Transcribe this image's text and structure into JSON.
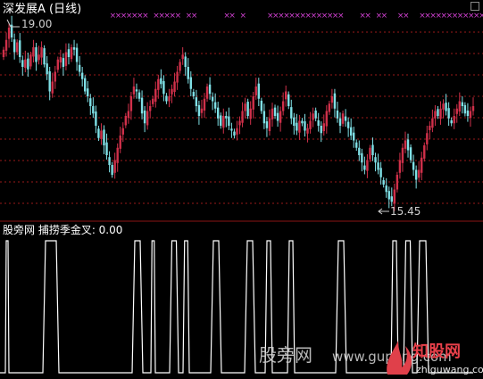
{
  "upper_panel": {
    "title": "深发展A (日线)",
    "max_label": "19.00",
    "min_label": "15.45"
  },
  "lower_panel": {
    "title": "股旁网 捕捞季金叉: 0.00"
  },
  "watermarks": {
    "site1": "股旁网",
    "site1_url": "www.gupang.com",
    "site2": "知股网",
    "site2_url": "zhiguwang.com"
  },
  "colors": {
    "up": "#d0304a",
    "down": "#7fe0e6",
    "signal_marker": "#d040d0",
    "indicator_line": "#ffffff",
    "grid": "#9a1a1a",
    "background": "#000000"
  },
  "chart_data": [
    {
      "type": "candlestick",
      "title": "深发展A (日线)",
      "ylim": [
        15.2,
        19.2
      ],
      "annotations": [
        {
          "text": "19.00",
          "at_index": 2,
          "price": 19.0
        },
        {
          "text": "15.45",
          "at_index": 152,
          "price": 15.45
        }
      ],
      "closes": [
        18.55,
        18.75,
        19.0,
        18.8,
        18.5,
        18.7,
        18.4,
        18.2,
        18.35,
        18.15,
        18.45,
        18.6,
        18.3,
        18.45,
        18.6,
        18.25,
        18.05,
        17.7,
        17.9,
        18.1,
        18.35,
        18.4,
        18.2,
        18.5,
        18.4,
        18.6,
        18.55,
        18.3,
        18.1,
        17.95,
        17.7,
        17.6,
        17.4,
        17.25,
        17.0,
        16.75,
        16.9,
        16.6,
        16.4,
        16.2,
        16.0,
        16.3,
        16.55,
        16.8,
        16.95,
        17.2,
        17.3,
        17.6,
        17.8,
        17.7,
        17.55,
        17.25,
        17.05,
        17.3,
        17.4,
        17.55,
        17.75,
        17.95,
        17.85,
        17.65,
        17.5,
        17.6,
        17.75,
        17.9,
        18.1,
        18.3,
        18.45,
        18.2,
        17.95,
        17.75,
        17.6,
        17.4,
        17.2,
        17.35,
        17.55,
        17.8,
        17.65,
        17.5,
        17.35,
        17.15,
        17.0,
        17.2,
        17.15,
        17.0,
        16.9,
        16.8,
        16.95,
        17.1,
        17.3,
        17.45,
        17.2,
        17.35,
        17.6,
        17.8,
        17.55,
        17.3,
        17.05,
        16.95,
        17.15,
        17.35,
        17.2,
        17.1,
        17.3,
        17.5,
        17.7,
        17.4,
        17.15,
        17.0,
        16.9,
        17.1,
        17.05,
        16.9,
        16.95,
        17.1,
        17.25,
        17.15,
        17.0,
        16.85,
        17.05,
        17.3,
        17.45,
        17.6,
        17.35,
        17.15,
        17.0,
        17.25,
        17.1,
        16.95,
        16.8,
        16.7,
        16.55,
        16.4,
        16.25,
        16.1,
        16.3,
        16.55,
        16.4,
        16.25,
        16.1,
        15.95,
        15.8,
        15.65,
        15.5,
        15.45,
        15.7,
        16.0,
        16.3,
        16.55,
        16.7,
        16.5,
        16.3,
        16.1,
        15.9,
        16.1,
        16.35,
        16.6,
        16.85,
        17.0,
        17.15,
        17.3,
        17.2,
        17.35,
        17.45,
        17.3,
        17.15,
        17.05,
        17.2,
        17.35,
        17.5,
        17.4,
        17.25,
        17.2,
        17.3,
        17.4
      ],
      "signal_marks_at_index": [
        40,
        42,
        44,
        46,
        48,
        50,
        52,
        56,
        58,
        60,
        62,
        64,
        68,
        70,
        82,
        84,
        88,
        98,
        100,
        102,
        104,
        106,
        108,
        110,
        112,
        114,
        116,
        118,
        120,
        122,
        124,
        132,
        134,
        138,
        140,
        146,
        148,
        154,
        156,
        158,
        160,
        162,
        164,
        166,
        168,
        170,
        172,
        174,
        176,
        178,
        180,
        184
      ]
    },
    {
      "type": "line",
      "title": "股旁网 捕捞季金叉: 0.00",
      "ylim": [
        0,
        1
      ],
      "segments": [
        [
          6,
          10
        ],
        [
          48,
          66
        ],
        [
          148,
          160
        ],
        [
          169,
          174
        ],
        [
          190,
          200
        ],
        [
          205,
          212
        ],
        [
          236,
          248
        ],
        [
          274,
          286
        ],
        [
          297,
          305
        ],
        [
          322,
          330
        ],
        [
          376,
          388
        ],
        [
          438,
          446
        ],
        [
          452,
          462
        ],
        [
          467,
          480
        ]
      ],
      "x_span": [
        0,
        530
      ]
    }
  ]
}
